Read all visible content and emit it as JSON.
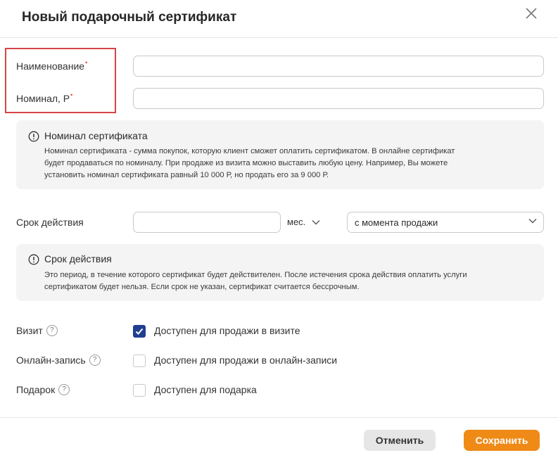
{
  "dialog": {
    "title": "Новый подарочный сертификат"
  },
  "form": {
    "name_label": "Наименование",
    "nominal_label": "Номинал, Р",
    "required_mark": "•",
    "name_value": "",
    "nominal_value": ""
  },
  "nominal_info": {
    "title": "Номинал сертификата",
    "lines": [
      "Номинал сертификата - сумма покупок, которую клиент сможет оплатить сертификатом. В онлайне сертификат",
      "будет продаваться по номиналу. При продаже из визита можно выставить любую цену. Например, Вы можете",
      "установить номинал сертификата равный 10 000 Р, но продать его за 9 000 Р."
    ]
  },
  "validity": {
    "label": "Срок действия",
    "value": "",
    "unit": "мес.",
    "from_option": "с момента продажи"
  },
  "validity_info": {
    "title": "Срок действия",
    "lines": [
      "Это период, в течение которого сертификат будет действителен. После истечения срока действия оплатить услуги",
      "сертификатом будет нельзя. Если срок не указан, сертификат считается бессрочным."
    ]
  },
  "availability": [
    {
      "label": "Визит",
      "help": "?",
      "option": "Доступен для продажи в визите",
      "checked": true
    },
    {
      "label": "Онлайн-запись",
      "help": "?",
      "option": "Доступен для продажи в онлайн-записи",
      "checked": false
    },
    {
      "label": "Подарок",
      "help": "?",
      "option": "Доступен для подарка",
      "checked": false
    }
  ],
  "footer": {
    "cancel_label": "Отменить",
    "save_label": "Сохранить"
  },
  "colors": {
    "accent": "#ef8a17",
    "checkbox_checked": "#1f3f8f",
    "required": "#e53935",
    "highlight": "#d64545"
  }
}
